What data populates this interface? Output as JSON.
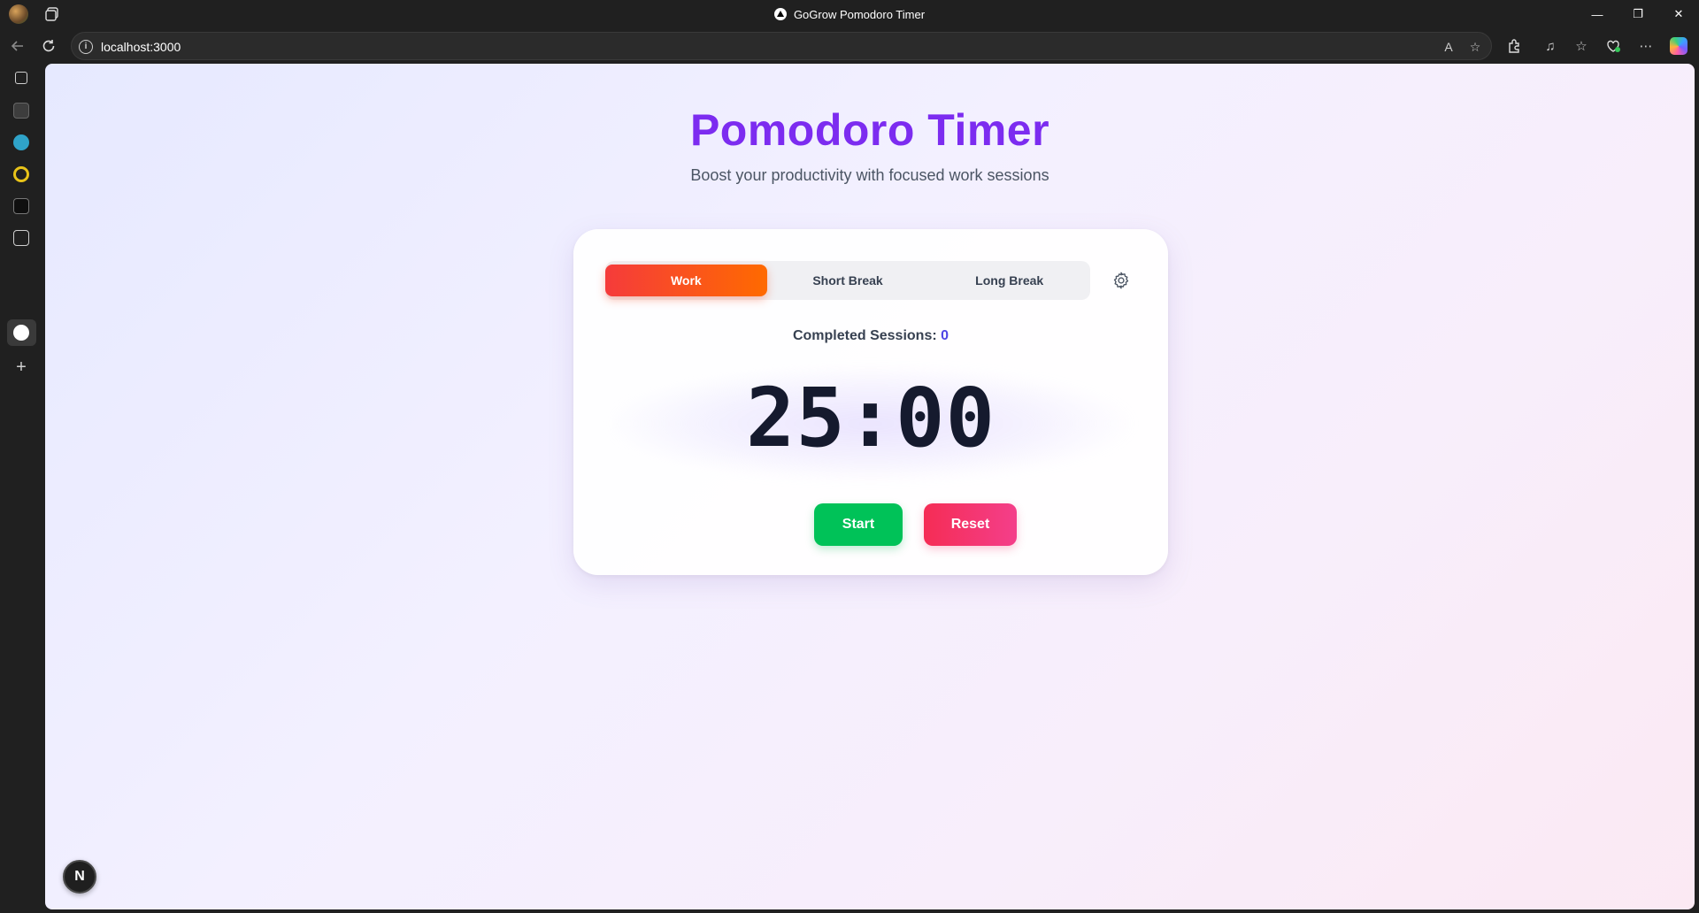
{
  "window": {
    "title": "GoGrow Pomodoro Timer",
    "controls": {
      "minimize": "—",
      "restore": "❐",
      "close": "✕"
    }
  },
  "browser": {
    "url": "localhost:3000",
    "sidebar_icons": [
      "vertical-tabs-icon",
      "app-icon-1",
      "check-app-icon",
      "spiral-app-icon",
      "app-icon-2",
      "document-app-icon",
      "pomodoro-tab-icon",
      "add-icon"
    ],
    "toolbar_icons": [
      "read-aloud-icon",
      "favorite-star-icon",
      "extensions-icon",
      "media-icon",
      "favorites-icon",
      "browser-essentials-icon",
      "more-icon",
      "copilot-icon"
    ]
  },
  "page": {
    "title": "Pomodoro Timer",
    "subtitle": "Boost your productivity with focused work sessions",
    "modes": [
      {
        "label": "Work",
        "active": true
      },
      {
        "label": "Short Break",
        "active": false
      },
      {
        "label": "Long Break",
        "active": false
      }
    ],
    "sessions_label": "Completed Sessions:",
    "sessions_count": "0",
    "time": "25:00",
    "start_label": "Start",
    "reset_label": "Reset",
    "nextjs_badge": "N"
  },
  "colors": {
    "title": "#7c2cf0",
    "work_tab_gradient": [
      "#f53b3b",
      "#ff6a00"
    ],
    "start_button": "#00c258",
    "reset_button": [
      "#f52c55",
      "#f43f8a"
    ],
    "sessions_count": "#4f46e5"
  }
}
